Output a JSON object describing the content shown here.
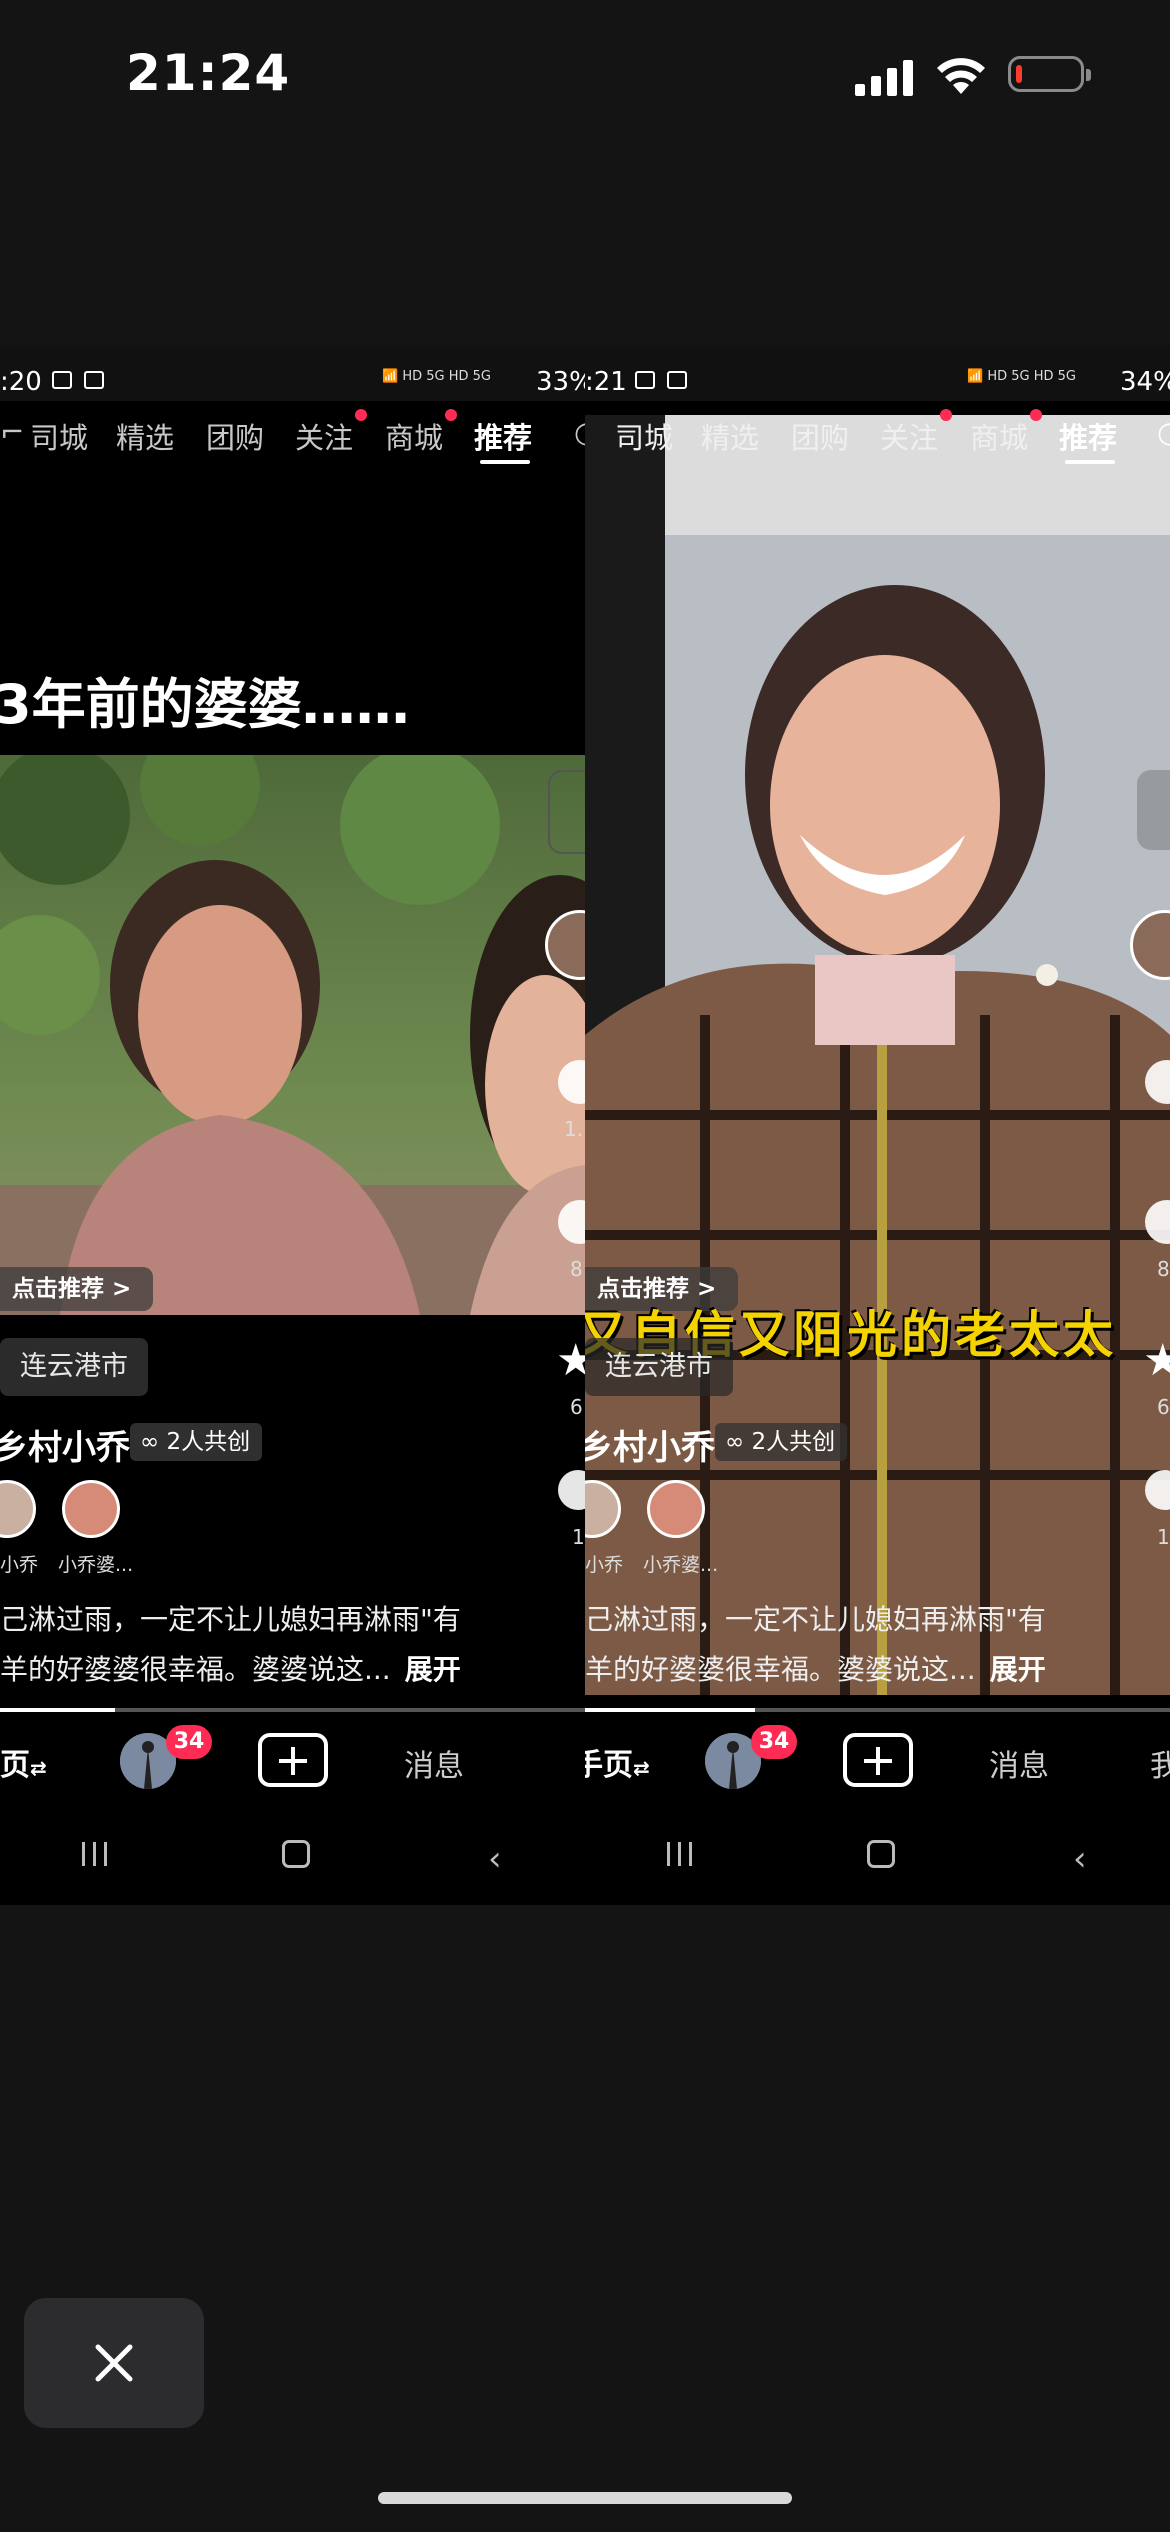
{
  "ios_status": {
    "time": "21:24"
  },
  "panels": {
    "left": {
      "status_time": ":20",
      "status_pct": "33%",
      "tabs": [
        "司城",
        "精选",
        "团购",
        "关注",
        "商城",
        "推荐"
      ],
      "title": "3年前的婆婆……",
      "recommend_chip": "点击推荐 >",
      "location": "连云港市",
      "author": "乡村小乔",
      "cocreate": "2人共创",
      "co_names": [
        "小乔",
        "小乔婆..."
      ],
      "desc_line1": "己淋过雨，一定不让儿媳妇再淋雨\"有",
      "desc_line2": "羊的好婆婆很幸福。婆婆说这...",
      "desc_more": "展开",
      "side_nums": [
        "1.",
        "8",
        "6",
        "1"
      ],
      "nav_home": "页",
      "nav_badge": "34",
      "nav_msg": "消息"
    },
    "right": {
      "status_time": ":21",
      "status_pct": "34%",
      "tabs": [
        "司城",
        "精选",
        "团购",
        "关注",
        "商城",
        "推荐"
      ],
      "caption": "又自信又阳光的老太太",
      "recommend_chip": "点击推荐 >",
      "location": "连云港市",
      "author": "乡村小乔",
      "cocreate": "2人共创",
      "co_names": [
        "小乔",
        "小乔婆..."
      ],
      "desc_line1": "己淋过雨，一定不让儿媳妇再淋雨\"有",
      "desc_line2": "羊的好婆婆很幸福。婆婆说这...",
      "desc_more": "展开",
      "side_nums": [
        "8",
        "6",
        "1"
      ],
      "nav_home": "手页",
      "nav_badge": "34",
      "nav_msg": "消息",
      "nav_me": "我"
    }
  },
  "colors": {
    "accent_red": "#fe2c55",
    "background": "#141414"
  }
}
